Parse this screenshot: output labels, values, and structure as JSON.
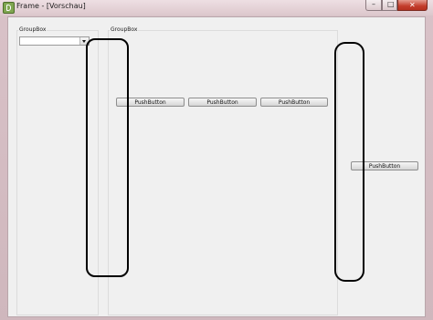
{
  "window": {
    "title": "Frame - [Vorschau]",
    "icons": {
      "app": "qt-designer-icon",
      "minimize": "minimize-icon",
      "maximize": "maximize-icon",
      "close": "close-icon"
    },
    "buttons": {
      "minimize_glyph": "–",
      "maximize_glyph": "□",
      "close_glyph": "✕"
    },
    "colors": {
      "frame": "#d9c2c8",
      "client": "#f0f0f0",
      "close": "#c33d2c"
    }
  },
  "groupboxes": [
    {
      "title": "GroupBox"
    },
    {
      "title": "GroupBox"
    }
  ],
  "combobox": {
    "value": ""
  },
  "pushbuttons": [
    {
      "label": "PushButton"
    },
    {
      "label": "PushButton"
    },
    {
      "label": "PushButton"
    },
    {
      "label": "PushButton"
    }
  ]
}
